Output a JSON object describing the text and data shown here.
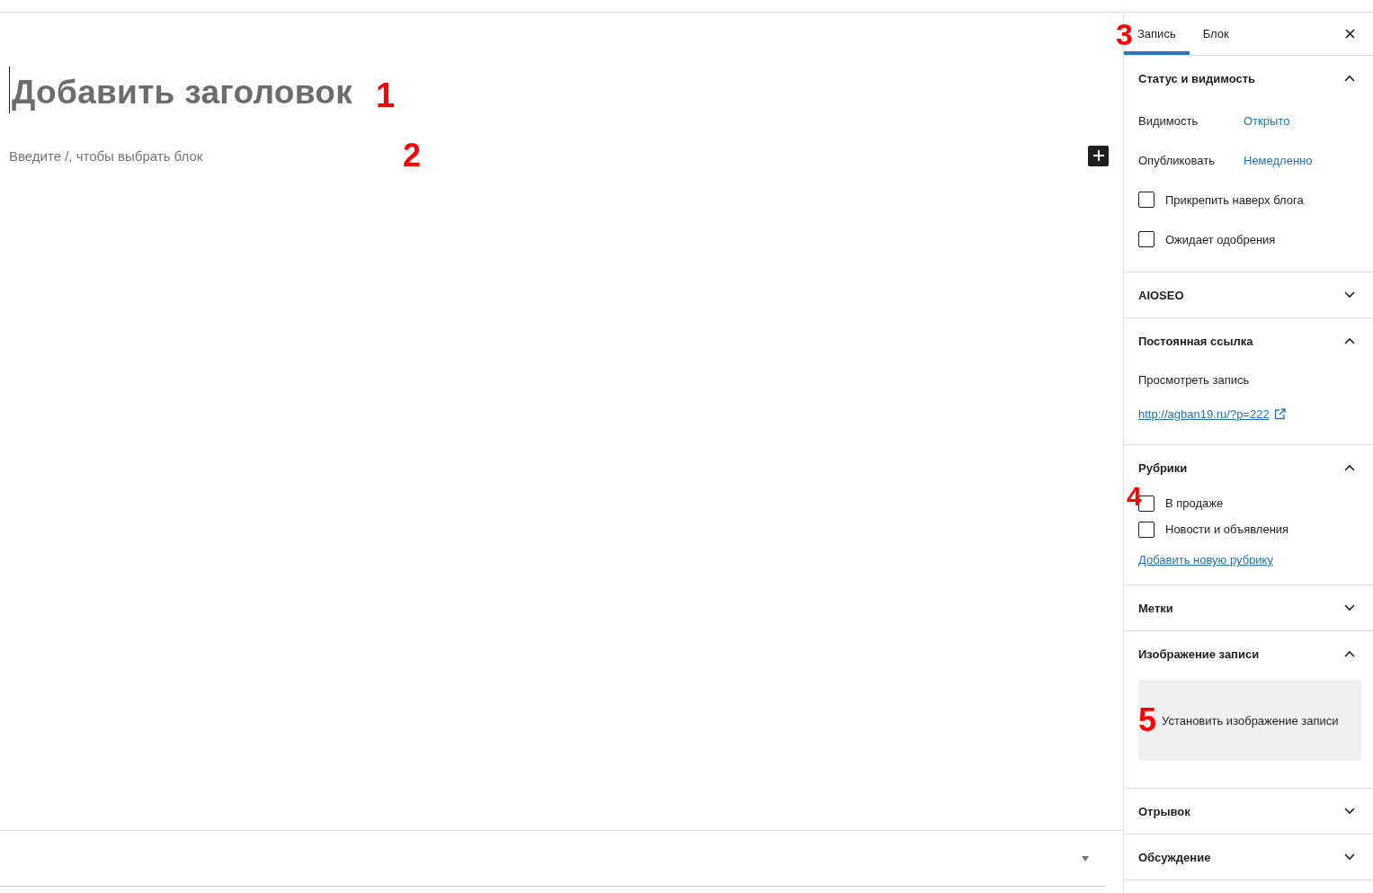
{
  "editor": {
    "title_placeholder": "Добавить заголовок",
    "title_marker": "1",
    "block_placeholder": "Введите /, чтобы выбрать блок",
    "block_marker": "2"
  },
  "sidebar": {
    "tabs": [
      {
        "label": "Запись",
        "selected": true,
        "marker": "3"
      },
      {
        "label": "Блок",
        "selected": false
      }
    ],
    "panels": [
      {
        "title": "Статус и видимость",
        "expanded": true,
        "items": [
          {
            "kind": "setting",
            "label": "Видимость",
            "value": "Открыто"
          },
          {
            "kind": "setting",
            "label": "Опубликовать",
            "value": "Немедленно"
          },
          {
            "kind": "checkbox",
            "label": "Прикрепить наверх блога",
            "checked": false
          },
          {
            "kind": "checkbox",
            "label": "Ожидает одобрения",
            "checked": false
          }
        ]
      },
      {
        "title": "AIOSEO",
        "expanded": false
      },
      {
        "title": "Постоянная ссылка",
        "expanded": true,
        "items": [
          {
            "kind": "text",
            "label": "Просмотреть запись"
          },
          {
            "kind": "external_link",
            "label": "http://agban19.ru/?p=222"
          }
        ]
      },
      {
        "title": "Рубрики",
        "expanded": true,
        "items": [
          {
            "kind": "category",
            "label": "В продаже",
            "checked": false,
            "marker": "4"
          },
          {
            "kind": "category",
            "label": "Новости и объявления",
            "checked": false
          },
          {
            "kind": "link",
            "label": "Добавить новую рубрику"
          }
        ]
      },
      {
        "title": "Метки",
        "expanded": false
      },
      {
        "title": "Изображение записи",
        "expanded": true,
        "items": [
          {
            "kind": "image_button",
            "label": "Установить изображение записи",
            "marker": "5"
          }
        ]
      },
      {
        "title": "Отрывок",
        "expanded": false
      },
      {
        "title": "Обсуждение",
        "expanded": false
      }
    ]
  }
}
